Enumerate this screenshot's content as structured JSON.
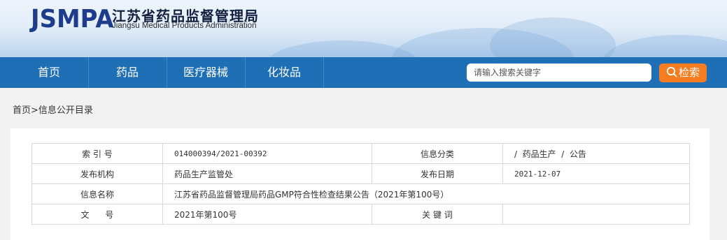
{
  "header": {
    "logo_abbr": "JSMPA",
    "logo_cn": "江苏省药品监督管理局",
    "logo_en": "Jiangsu Medical Products Administration"
  },
  "nav": {
    "items": [
      "首页",
      "药品",
      "医疗器械",
      "化妆品"
    ]
  },
  "search": {
    "placeholder": "请输入搜索关键字",
    "button_label": "检索"
  },
  "breadcrumb": {
    "home": "首页",
    "separator": ">",
    "current": "信息公开目录"
  },
  "info_table": {
    "index_label": "索 引 号",
    "index_value": "014000394/2021-00392",
    "category_label": "信息分类",
    "category_value": "/  药品生产  /  公告",
    "publisher_label": "发布机构",
    "publisher_value": "药品生产监管处",
    "date_label": "发布日期",
    "date_value": "2021-12-07",
    "name_label": "信息名称",
    "name_value": "江苏省药品监督管理局药品GMP符合性检查结果公告（2021年第100号）",
    "docno_label": "文      号",
    "docno_value": "2021年第100号",
    "keywords_label": "关 键 词",
    "keywords_value": ""
  },
  "colors": {
    "nav_bg": "#1f6fb6",
    "search_button": "#f57c1f",
    "logo_blue": "#1e3c8c"
  }
}
